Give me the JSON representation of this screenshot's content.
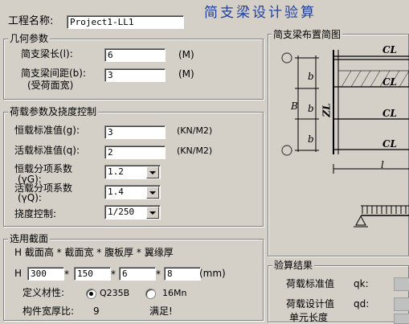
{
  "app": {
    "title": "简支梁设计验算",
    "colors": {
      "title": "#1f3f9f",
      "panel": "#d4d0c8",
      "diagram_bg": "#d4d0c8"
    }
  },
  "project": {
    "label": "工程名称:",
    "value": "Project1-LL1"
  },
  "geometry": {
    "title": "几何参数",
    "span_label": "简支梁长(l):",
    "span_value": "6",
    "span_unit": "(M)",
    "spacing_label_1": "简支梁间距(b):",
    "spacing_label_2": "(受荷面宽)",
    "spacing_value": "3",
    "spacing_unit": "(M)"
  },
  "loads": {
    "title": "荷载参数及挠度控制",
    "dead_label": "恒载标准值(g):",
    "dead_value": "3",
    "dead_unit": "(KN/M2)",
    "live_label": "活载标准值(q):",
    "live_value": "2",
    "live_unit": "(KN/M2)",
    "dead_factor_label_1": "恒载分项系数",
    "dead_factor_label_2": "(γG):",
    "dead_factor_value": "1.2",
    "live_factor_label_1": "活载分项系数",
    "live_factor_label_2": "(γQ):",
    "live_factor_value": "1.4",
    "deflection_label": "挠度控制:",
    "deflection_value": "1/250"
  },
  "section": {
    "title": "选用截面",
    "desc": "H 截面高 * 截面宽 * 腹板厚 * 翼缘厚",
    "prefix": "H",
    "height": "300",
    "width": "150",
    "web": "6",
    "flange": "8",
    "mult": "*",
    "unit": "(mm)",
    "material_label": "定义材性:",
    "material_options": [
      "Q235B",
      "16Mn"
    ],
    "material_selected": "Q235B",
    "ratio_label": "构件宽厚比:",
    "ratio_value": "9",
    "ratio_status": "满足!"
  },
  "diagram": {
    "title": "简支梁布置简图",
    "cl_labels": [
      "CL",
      "CL",
      "CL",
      "CL"
    ],
    "b_labels": [
      "b",
      "b",
      "b",
      "b"
    ],
    "B_label": "B",
    "ZL_label": "ZL",
    "l_label": "l"
  },
  "results": {
    "title": "验算结果",
    "rows": [
      {
        "label": "荷载标准值",
        "symbol": "qk:"
      },
      {
        "label": "荷载设计值",
        "symbol": "qd:"
      },
      {
        "label": "单元长度",
        "symbol": ""
      }
    ]
  }
}
